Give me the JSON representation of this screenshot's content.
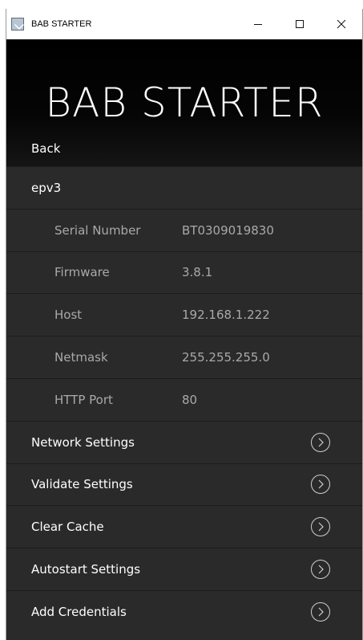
{
  "window": {
    "title": "BAB STARTER",
    "minimize_symbol": "—",
    "close_symbol": "✕"
  },
  "header": {
    "brand": "BAB STARTER",
    "back_label": "Back"
  },
  "device": {
    "name": "epv3",
    "info": [
      {
        "label": "Serial Number",
        "value": "BT0309019830"
      },
      {
        "label": "Firmware",
        "value": "3.8.1"
      },
      {
        "label": "Host",
        "value": "192.168.1.222"
      },
      {
        "label": "Netmask",
        "value": "255.255.255.0"
      },
      {
        "label": "HTTP Port",
        "value": "80"
      }
    ]
  },
  "actions": [
    {
      "label": "Network Settings",
      "icon": "chevron-circle-right-icon"
    },
    {
      "label": "Validate Settings",
      "icon": "chevron-circle-right-icon"
    },
    {
      "label": "Clear Cache",
      "icon": "chevron-circle-right-icon"
    },
    {
      "label": "Autostart Settings",
      "icon": "chevron-circle-right-icon"
    },
    {
      "label": "Add Credentials",
      "icon": "chevron-circle-right-icon"
    }
  ],
  "colors": {
    "background": "#2a2a2a",
    "header": "#000000",
    "primary_text": "#ffffff",
    "secondary_text": "#a9a9a9"
  }
}
